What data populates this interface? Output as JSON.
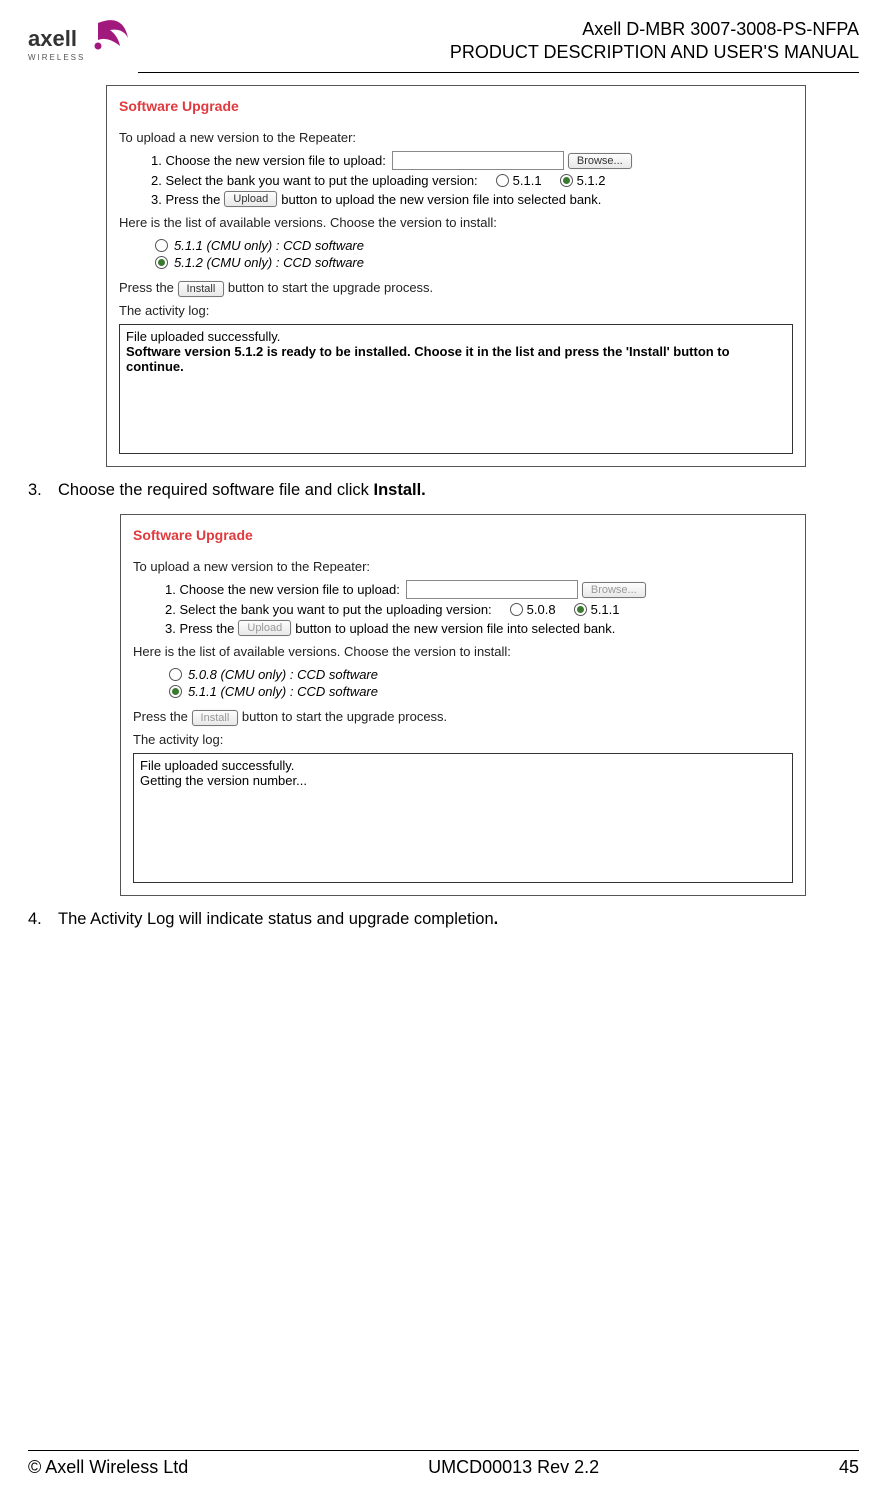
{
  "header": {
    "logo_name": "axell",
    "logo_sub": "WIRELESS",
    "line1": "Axell D-MBR 3007-3008-PS-NFPA",
    "line2": "PRODUCT DESCRIPTION AND USER'S MANUAL"
  },
  "panel1": {
    "title": "Software Upgrade",
    "intro": "To upload a new version to the Repeater:",
    "step1": "1. Choose the new version file to upload:",
    "browse_label": "Browse...",
    "step2_pre": "2. Select the bank you want to put the uploading version:",
    "bank_a": "5.1.1",
    "bank_a_selected": false,
    "bank_b": "5.1.2",
    "bank_b_selected": true,
    "step3_pre": "3. Press the",
    "upload_label": "Upload",
    "upload_disabled": false,
    "step3_post": "button to upload the new version file into selected bank.",
    "avail_text": "Here is the list of available versions. Choose the version to install:",
    "versions": [
      {
        "label": "5.1.1 (CMU only) : CCD software",
        "selected": false
      },
      {
        "label": "5.1.2 (CMU only) : CCD software",
        "selected": true
      }
    ],
    "press_pre": "Press the",
    "install_label": "Install",
    "install_disabled": false,
    "press_post": "button to start the upgrade process.",
    "log_label": "The activity log:",
    "log_line1": "File uploaded successfully.",
    "log_line2": "Software version 5.1.2 is ready to be installed. Choose it in the list and press the 'Install' button to continue."
  },
  "step3": {
    "num": "3.",
    "text": "Choose the required software file and click ",
    "bold": "Install."
  },
  "panel2": {
    "title": "Software Upgrade",
    "intro": "To upload a new version to the Repeater:",
    "step1": "1. Choose the new version file to upload:",
    "browse_label": "Browse...",
    "browse_disabled": true,
    "step2_pre": "2. Select the bank you want to put the uploading version:",
    "bank_a": "5.0.8",
    "bank_a_selected": false,
    "bank_b": "5.1.1",
    "bank_b_selected": true,
    "step3_pre": "3. Press the",
    "upload_label": "Upload",
    "upload_disabled": true,
    "step3_post": "button to upload the new version file into selected bank.",
    "avail_text": "Here is the list of available versions. Choose the version to install:",
    "versions": [
      {
        "label": "5.0.8 (CMU only) : CCD software",
        "selected": false
      },
      {
        "label": "5.1.1 (CMU only) : CCD software",
        "selected": true
      }
    ],
    "press_pre": "Press the",
    "install_label": "Install",
    "install_disabled": true,
    "press_post": "button to start the upgrade process.",
    "log_label": "The activity log:",
    "log_line1": "File uploaded successfully.",
    "log_line2": "Getting the version number..."
  },
  "step4": {
    "num": "4.",
    "text": "The Activity Log will indicate status and upgrade completion",
    "bold": "."
  },
  "footer": {
    "left": "© Axell Wireless Ltd",
    "center": "UMCD00013 Rev 2.2",
    "right": "45"
  }
}
